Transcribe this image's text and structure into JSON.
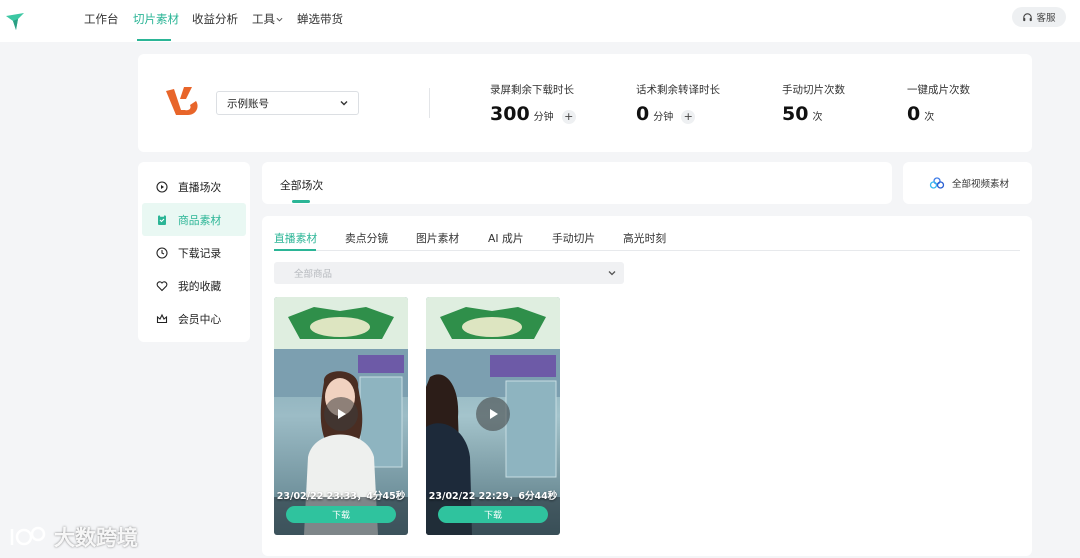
{
  "nav": {
    "items": [
      "工作台",
      "切片素材",
      "收益分析",
      "工具",
      "蝉选带货"
    ],
    "active_index": 1,
    "service_label": "客服"
  },
  "account": {
    "name": "示例账号",
    "stats": [
      {
        "label": "录屏剩余下载时长",
        "value": "300",
        "unit": "分钟",
        "has_plus": true
      },
      {
        "label": "话术剩余转译时长",
        "value": "0",
        "unit": "分钟",
        "has_plus": true
      },
      {
        "label": "手动切片次数",
        "value": "50",
        "unit": "次",
        "has_plus": false
      },
      {
        "label": "一键成片次数",
        "value": "0",
        "unit": "次",
        "has_plus": false
      }
    ]
  },
  "sidebar": {
    "items": [
      {
        "label": "直播场次",
        "icon": "play-circle-icon"
      },
      {
        "label": "商品素材",
        "icon": "clipboard-icon"
      },
      {
        "label": "下载记录",
        "icon": "clock-icon"
      },
      {
        "label": "我的收藏",
        "icon": "heart-icon"
      },
      {
        "label": "会员中心",
        "icon": "crown-icon"
      }
    ],
    "active_index": 1
  },
  "session": {
    "tab_label": "全部场次",
    "all_video_label": "全部视频素材"
  },
  "main": {
    "tabs": [
      "直播素材",
      "卖点分镜",
      "图片素材",
      "AI 成片",
      "手动切片",
      "高光时刻"
    ],
    "active_index": 0,
    "goods_placeholder": "全部商品",
    "cards": [
      {
        "caption": "23/02/22 23:33，4分45秒",
        "download_label": "下载"
      },
      {
        "caption": "23/02/22 22:29，6分44秒",
        "download_label": "下载"
      }
    ]
  },
  "watermark": "大数跨境",
  "colors": {
    "accent": "#2bb596",
    "brand_orange": "#e8652a",
    "download_btn": "#2fc39e"
  }
}
